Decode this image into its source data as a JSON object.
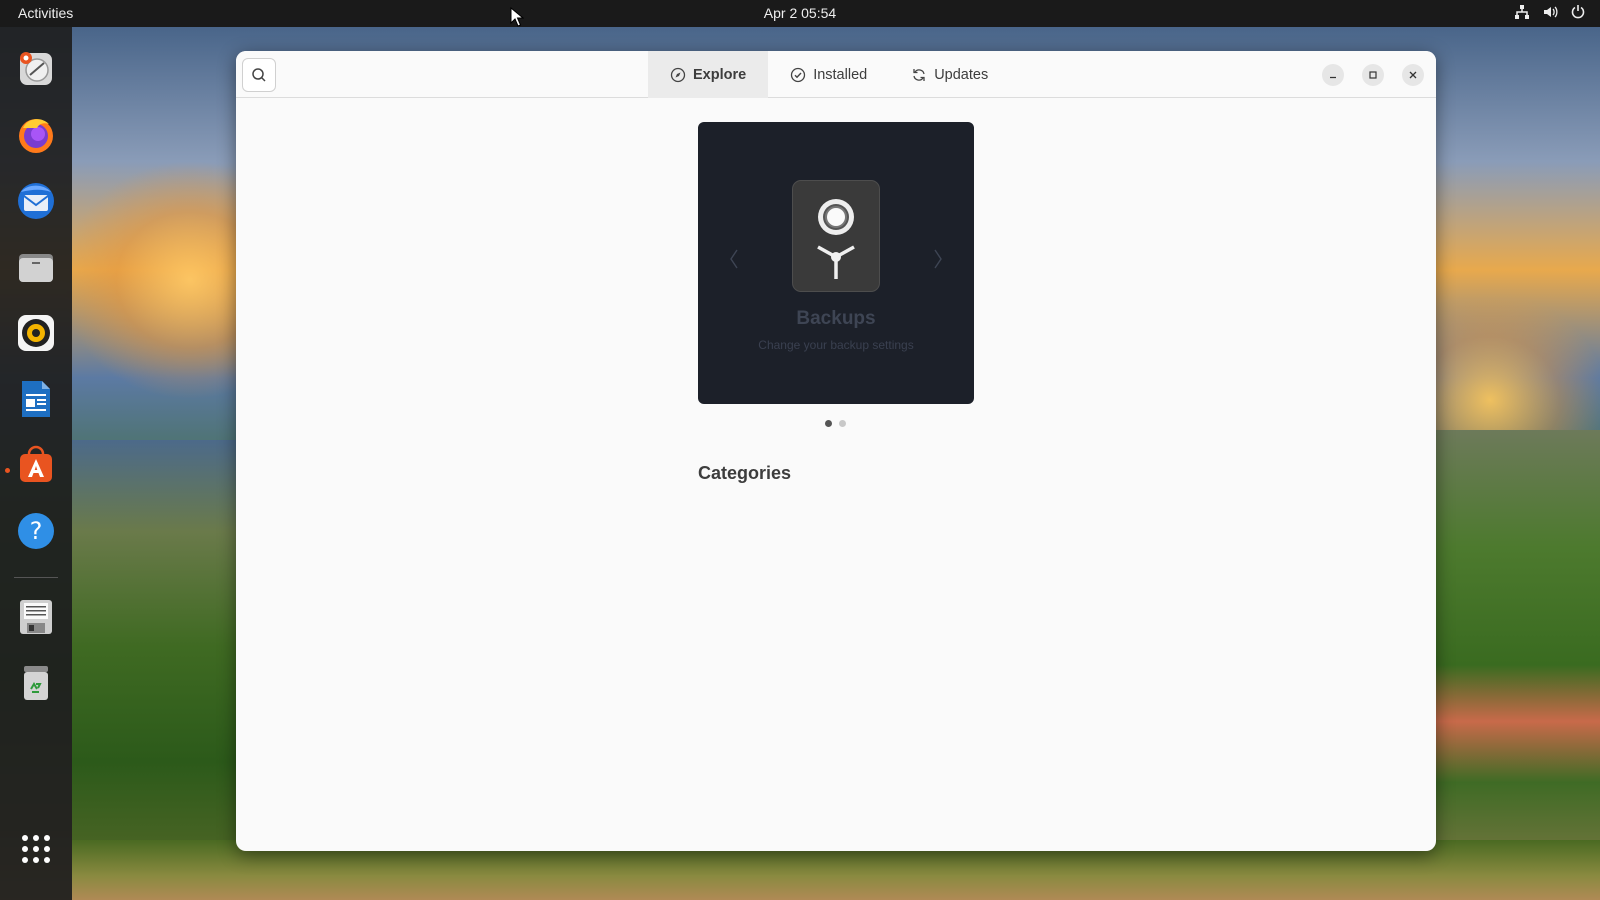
{
  "topbar": {
    "activities_label": "Activities",
    "clock": "Apr 2  05:54",
    "tray_icons": [
      "network-icon",
      "volume-icon",
      "power-icon"
    ]
  },
  "dock": {
    "items": [
      {
        "name": "screenshot-app-icon"
      },
      {
        "name": "firefox-icon"
      },
      {
        "name": "thunderbird-icon"
      },
      {
        "name": "files-icon"
      },
      {
        "name": "rhythmbox-icon"
      },
      {
        "name": "libreoffice-writer-icon"
      },
      {
        "name": "ubuntu-software-icon",
        "running": true
      },
      {
        "name": "help-icon"
      },
      {
        "name": "floppy-drive-icon"
      },
      {
        "name": "trash-icon"
      },
      {
        "name": "show-apps-icon"
      }
    ]
  },
  "window": {
    "search_icon": "search-icon",
    "tabs": [
      {
        "label": "Explore",
        "icon": "compass-icon",
        "active": true
      },
      {
        "label": "Installed",
        "icon": "check-circle-icon",
        "active": false
      },
      {
        "label": "Updates",
        "icon": "refresh-icon",
        "active": false
      }
    ],
    "controls": [
      "minimize-icon",
      "maximize-icon",
      "close-icon"
    ]
  },
  "carousel": {
    "title": "Backups",
    "subtitle": "Change your backup settings",
    "page_count": 2,
    "current_page": 1
  },
  "sections": {
    "categories_title": "Categories"
  },
  "colors": {
    "accent": "#e95420",
    "carousel_bg": "#1c2029",
    "window_bg": "#fafafa"
  }
}
